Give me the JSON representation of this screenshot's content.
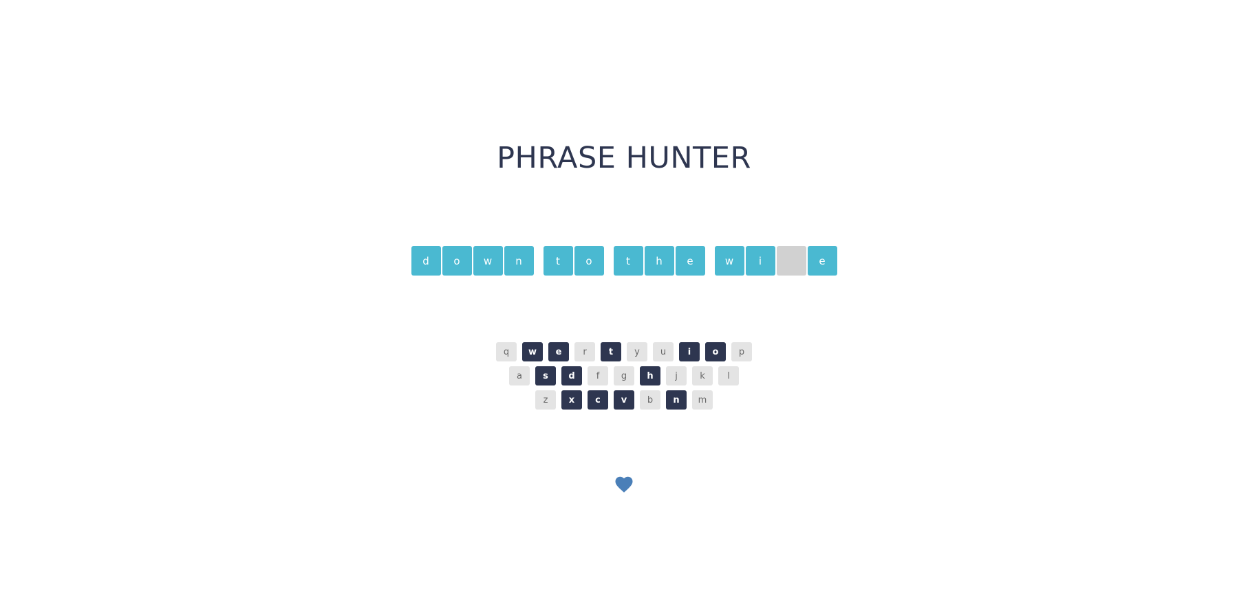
{
  "title": "PHRASE HUNTER",
  "phrase": {
    "words": [
      [
        {
          "letter": "d",
          "revealed": true
        },
        {
          "letter": "o",
          "revealed": true
        },
        {
          "letter": "w",
          "revealed": true
        },
        {
          "letter": "n",
          "revealed": true
        }
      ],
      [
        {
          "letter": "t",
          "revealed": true
        },
        {
          "letter": "o",
          "revealed": true
        }
      ],
      [
        {
          "letter": "t",
          "revealed": true
        },
        {
          "letter": "h",
          "revealed": true
        },
        {
          "letter": "e",
          "revealed": true
        }
      ],
      [
        {
          "letter": "w",
          "revealed": true
        },
        {
          "letter": "i",
          "revealed": true
        },
        {
          "letter": "",
          "revealed": false
        },
        {
          "letter": "e",
          "revealed": true
        }
      ]
    ]
  },
  "keyboard": {
    "rows": [
      [
        {
          "key": "q",
          "chosen": false
        },
        {
          "key": "w",
          "chosen": true
        },
        {
          "key": "e",
          "chosen": true
        },
        {
          "key": "r",
          "chosen": false
        },
        {
          "key": "t",
          "chosen": true
        },
        {
          "key": "y",
          "chosen": false
        },
        {
          "key": "u",
          "chosen": false
        },
        {
          "key": "i",
          "chosen": true
        },
        {
          "key": "o",
          "chosen": true
        },
        {
          "key": "p",
          "chosen": false
        }
      ],
      [
        {
          "key": "a",
          "chosen": false
        },
        {
          "key": "s",
          "chosen": true
        },
        {
          "key": "d",
          "chosen": true
        },
        {
          "key": "f",
          "chosen": false
        },
        {
          "key": "g",
          "chosen": false
        },
        {
          "key": "h",
          "chosen": true
        },
        {
          "key": "j",
          "chosen": false
        },
        {
          "key": "k",
          "chosen": false
        },
        {
          "key": "l",
          "chosen": false
        }
      ],
      [
        {
          "key": "z",
          "chosen": false
        },
        {
          "key": "x",
          "chosen": true
        },
        {
          "key": "c",
          "chosen": true
        },
        {
          "key": "v",
          "chosen": true
        },
        {
          "key": "b",
          "chosen": false
        },
        {
          "key": "n",
          "chosen": true
        },
        {
          "key": "m",
          "chosen": false
        }
      ]
    ]
  },
  "lives": {
    "remaining": 1,
    "icon": "heart-icon"
  },
  "colors": {
    "title": "#2e3650",
    "tile_revealed": "#4ab9d1",
    "tile_hidden": "#d1d1d1",
    "key_default": "#e4e4e4",
    "key_chosen": "#2e3650",
    "heart": "#4a7fb8"
  }
}
